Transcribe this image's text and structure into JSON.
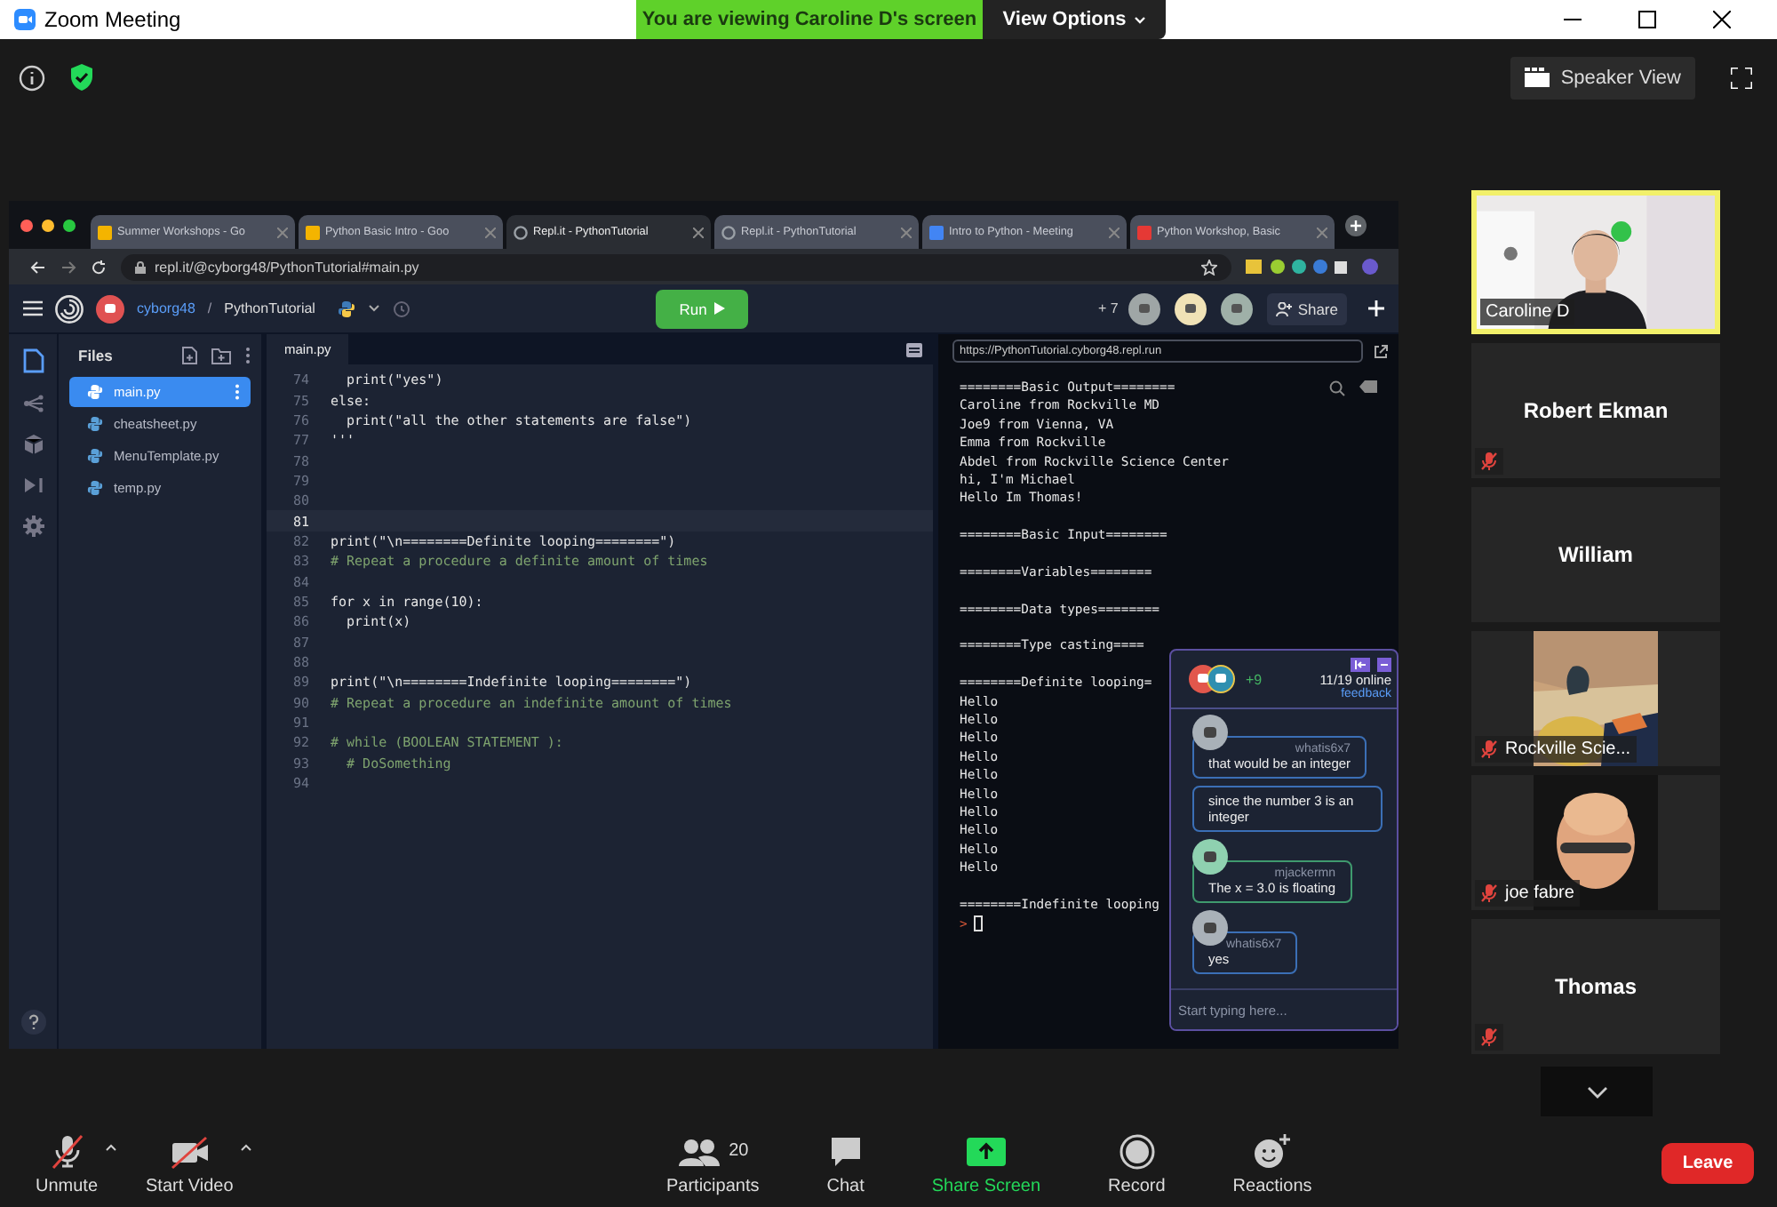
{
  "window": {
    "title": "Zoom Meeting"
  },
  "banner": {
    "text": "You are viewing Caroline D's screen",
    "menu": "View Options"
  },
  "top_bar": {
    "view_button": "Speaker View"
  },
  "shared_screen": {
    "browser": {
      "tabs": [
        {
          "title": "Summer Workshops - Go",
          "kind": "drive",
          "selected": false
        },
        {
          "title": "Python Basic Intro - Goo",
          "kind": "slides",
          "selected": false
        },
        {
          "title": "Repl.it - PythonTutorial",
          "kind": "repl",
          "selected": true
        },
        {
          "title": "Repl.it - PythonTutorial",
          "kind": "repl",
          "selected": false
        },
        {
          "title": "Intro to Python - Meeting",
          "kind": "docs",
          "selected": false
        },
        {
          "title": "Python Workshop, Basic",
          "kind": "brand",
          "selected": false
        }
      ],
      "url": "repl.it/@cyborg48/PythonTutorial#main.py"
    },
    "repl": {
      "user": "cyborg48",
      "separator": "/",
      "project": "PythonTutorial",
      "run": "Run",
      "extra_collaborators": "+ 7",
      "share": "Share",
      "files_title": "Files",
      "files": [
        {
          "name": "main.py",
          "selected": true
        },
        {
          "name": "cheatsheet.py",
          "selected": false
        },
        {
          "name": "MenuTemplate.py",
          "selected": false
        },
        {
          "name": "temp.py",
          "selected": false
        }
      ],
      "editor_tab": "main.py",
      "code": [
        {
          "number": "74",
          "text": "  print(\"yes\")",
          "kind": "code",
          "active": false
        },
        {
          "number": "75",
          "text": "else:",
          "kind": "code",
          "active": false
        },
        {
          "number": "76",
          "text": "  print(\"all the other statements are false\")",
          "kind": "code",
          "active": false
        },
        {
          "number": "77",
          "text": "'''",
          "kind": "code",
          "active": false
        },
        {
          "number": "78",
          "active": false
        },
        {
          "number": "79",
          "active": false
        },
        {
          "number": "80",
          "active": false
        },
        {
          "number": "81",
          "active": true
        },
        {
          "number": "82",
          "text": "print(\"\\n========Definite looping========\")",
          "kind": "code",
          "active": false
        },
        {
          "number": "83",
          "text": "# Repeat a procedure a definite amount of times",
          "kind": "comment",
          "active": false
        },
        {
          "number": "84",
          "active": false
        },
        {
          "number": "85",
          "text": "for x in range(10):",
          "kind": "code",
          "active": false
        },
        {
          "number": "86",
          "text": "  print(x)",
          "kind": "code",
          "active": false
        },
        {
          "number": "87",
          "active": false
        },
        {
          "number": "88",
          "active": false
        },
        {
          "number": "89",
          "text": "print(\"\\n========Indefinite looping========\")",
          "kind": "code",
          "active": false
        },
        {
          "number": "90",
          "text": "# Repeat a procedure an indefinite amount of times",
          "kind": "comment",
          "active": false
        },
        {
          "number": "91",
          "active": false
        },
        {
          "number": "92",
          "text": "# while (BOOLEAN STATEMENT ):",
          "kind": "comment",
          "active": false
        },
        {
          "number": "93",
          "text": "  # DoSomething",
          "kind": "comment",
          "active": false
        },
        {
          "number": "94",
          "active": false
        }
      ],
      "output_url": "https://PythonTutorial.cyborg48.repl.run",
      "output": [
        {
          "heading": "========Basic Output========",
          "lines": [
            "Caroline from Rockville MD",
            "Joe9 from Vienna, VA",
            "Emma from Rockville",
            "Abdel from Rockville Science Center",
            "hi, I'm Michael",
            "Hello Im Thomas!"
          ]
        },
        {
          "heading": "========Basic Input========"
        },
        {
          "heading": "========Variables========"
        },
        {
          "heading": "========Data types========"
        },
        {
          "heading": "========Type casting===="
        },
        {
          "heading": "========Definite looping=",
          "lines": [
            "Hello",
            "Hello",
            "Hello",
            "Hello",
            "Hello",
            "Hello",
            "Hello",
            "Hello",
            "Hello",
            "Hello"
          ]
        },
        {
          "heading": "========Indefinite looping"
        }
      ],
      "prompt": ">"
    },
    "chat": {
      "extra": "+9",
      "online": "11/19 online",
      "feedback": "feedback",
      "placeholder": "Start typing here...",
      "messages": [
        {
          "user": "whatis6x7",
          "text": "that would be an integer",
          "color": "#3b6fb6"
        },
        {
          "text": "since the number 3 is an integer",
          "color": "#3b6fb6"
        },
        {
          "user": "mjackermn",
          "text": "The x = 3.0 is floating",
          "color": "#3f9a6e"
        },
        {
          "user": "whatis6x7",
          "text": "yes",
          "color": "#3b6fb6"
        }
      ]
    }
  },
  "participants": [
    {
      "name": "Caroline D",
      "kind": "video",
      "speaking": true,
      "muted": false
    },
    {
      "name": "Robert Ekman",
      "kind": "name",
      "speaking": false,
      "muted": true
    },
    {
      "name": "William",
      "kind": "name",
      "speaking": false,
      "muted": false
    },
    {
      "name": "Rockville Scie...",
      "kind": "picture",
      "speaking": false,
      "muted": true
    },
    {
      "name": "joe fabre",
      "kind": "avatar",
      "speaking": false,
      "muted": true
    },
    {
      "name": "Thomas",
      "kind": "name",
      "speaking": false,
      "muted": true
    }
  ],
  "audio": {
    "label": "Unmute",
    "muted": true
  },
  "video": {
    "label": "Start Video",
    "stopped": true
  },
  "controls": [
    {
      "label": "Participants",
      "kind": "participants",
      "count": "20"
    },
    {
      "label": "Chat",
      "kind": "chat"
    },
    {
      "label": "Share Screen",
      "kind": "share"
    },
    {
      "label": "Record",
      "kind": "record"
    },
    {
      "label": "Reactions",
      "kind": "reactions"
    }
  ],
  "leave": "Leave"
}
